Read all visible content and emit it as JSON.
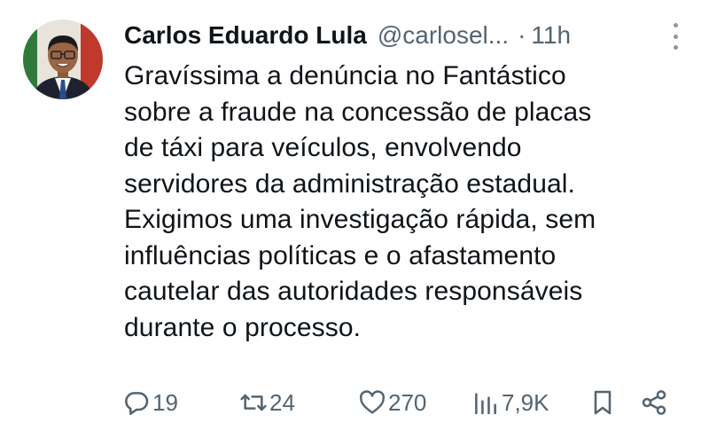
{
  "author": {
    "name": "Carlos Eduardo Lula",
    "handle": "@carlosel...",
    "separator": "·",
    "time": "11h"
  },
  "tweet": {
    "lines": [
      "Gravíssima a denúncia no Fantástico",
      "sobre a fraude na concessão de placas",
      "de táxi para veículos, envolvendo",
      "servidores da administração estadual.",
      "Exigimos uma investigação rápida, sem",
      "influências políticas e o afastamento",
      "cautelar das autoridades responsáveis",
      "durante o processo."
    ]
  },
  "actions": {
    "replies": "19",
    "reposts": "24",
    "likes": "270",
    "views": "7,9K"
  },
  "icons": {
    "reply": "reply-icon",
    "repost": "repost-icon",
    "like": "heart-icon",
    "views": "views-icon",
    "bookmark": "bookmark-icon",
    "share": "share-icon",
    "more": "more-vertical-icon"
  },
  "colors": {
    "text": "#0f1419",
    "secondary": "#536471"
  }
}
